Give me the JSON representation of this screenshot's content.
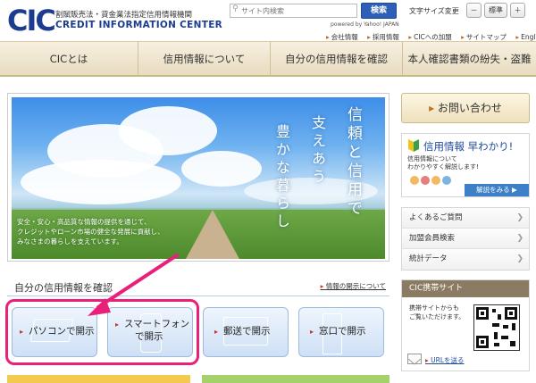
{
  "header": {
    "logo_mark": "CIC",
    "logo_subtitle": "割賦販売法・貸金業法指定信用情報機関",
    "logo_english": "CREDIT INFORMATION CENTER",
    "search": {
      "placeholder": "サイト内検索",
      "button": "検索",
      "powered_by": "powered by Yahoo! JAPAN"
    },
    "font_size": {
      "label": "文字サイズ変更",
      "decrease": "－",
      "standard": "標準",
      "increase": "＋"
    },
    "util_nav": [
      "会社情報",
      "採用情報",
      "CICへの加盟",
      "サイトマップ",
      "English"
    ]
  },
  "global_nav": [
    "CICとは",
    "信用情報について",
    "自分の信用情報を確認",
    "本人確認書類の紛失・盗難"
  ],
  "hero": {
    "vertical_text_1": "信頼と信用で",
    "vertical_text_2": "支えあう",
    "vertical_text_3": "豊かな暮らし",
    "caption": [
      "安全・安心・高品質な情報の提供を通じて、",
      "クレジットやローン市場の健全な発展に貢献し、",
      "みなさまの暮らしを支えています。"
    ]
  },
  "confirm": {
    "title": "自分の信用情報を確認",
    "link": "情報の開示について",
    "cards": [
      "パソコンで開示",
      "スマートフォン",
      "で開示",
      "郵送で開示",
      "窓口で開示"
    ]
  },
  "sidebar": {
    "contact": "お問い合わせ",
    "banner": {
      "title": "信用情報 早わかり!",
      "sub": [
        "信用情報について",
        "わかりやすく解説します!"
      ],
      "more": "解説をみる ▶"
    },
    "links": [
      "よくあるご質問",
      "加盟会員検索",
      "統計データ"
    ],
    "mobile": {
      "title": "CIC携帯サイト",
      "text": [
        "携帯サイトからも",
        "ご覧いただけます。"
      ],
      "link": "URLを送る"
    }
  },
  "colors": {
    "brand": "#1c3d8f",
    "highlight": "#e8207a",
    "accent_bar": "#f3c94e"
  }
}
